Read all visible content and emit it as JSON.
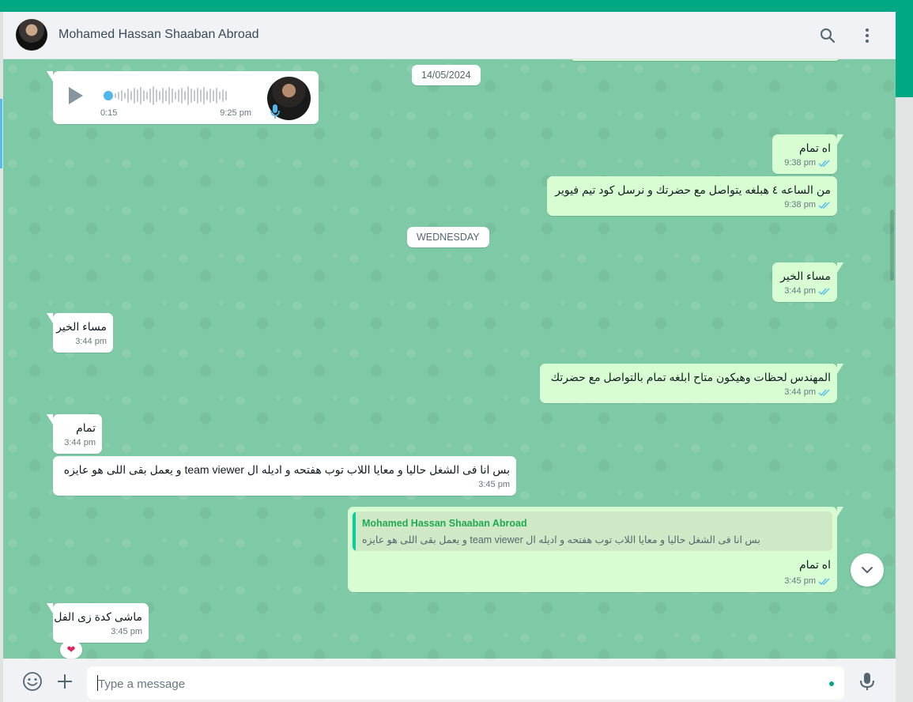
{
  "contact": {
    "name": "Mohamed Hassan Shaaban Abroad"
  },
  "dates": {
    "first": "14/05/2024",
    "second": "WEDNESDAY"
  },
  "voice_note": {
    "duration": "0:15",
    "time": "9:25 pm"
  },
  "messages": [
    {
      "dir": "out",
      "text": "اه تمام",
      "time": "9:38 pm"
    },
    {
      "dir": "out",
      "text": "من الساعه ٤ هبلغه يتواصل مع حضرتك و نرسل كود تيم فيوير",
      "time": "9:38 pm"
    },
    {
      "dir": "out",
      "text": "مساء الخير",
      "time": "3:44 pm"
    },
    {
      "dir": "in",
      "text": "مساء الخير",
      "time": "3:44 pm"
    },
    {
      "dir": "out",
      "text": "المهندس لحظات وهيكون متاح ابلغه تمام بالتواصل مع حضرتك",
      "time": "3:44 pm"
    },
    {
      "dir": "in",
      "text": "تمام",
      "time": "3:44 pm"
    },
    {
      "dir": "in",
      "text": "بس انا فى الشغل حاليا و معايا اللاب توب هفتحه و اديله ال team viewer و يعمل بقى اللى هو عايزه",
      "time": "3:45 pm"
    },
    {
      "dir": "out",
      "text": "اه تمام",
      "time": "3:45 pm"
    },
    {
      "dir": "in",
      "text": "ماشى كدة زى الفل",
      "time": "3:45 pm"
    }
  ],
  "quoted": {
    "name": "Mohamed Hassan Shaaban Abroad",
    "text": "بس انا فى الشغل حاليا و معايا اللاب توب هفتحه و اديله ال team viewer و يعمل بقى اللى هو عايزه"
  },
  "reaction": {
    "emoji": "❤"
  },
  "composer": {
    "placeholder": "Type a message"
  },
  "icons": {
    "search": "search-icon",
    "menu": "menu-icon",
    "emoji": "emoji-icon",
    "attach": "plus-icon",
    "mic": "mic-icon",
    "play": "play-icon",
    "scroll_down": "chevron-down-icon",
    "read": "double-check-icon"
  },
  "colors": {
    "accent": "#00a884",
    "outgoing": "#d9fdd3",
    "incoming": "#ffffff",
    "read_tick": "#53bdeb"
  }
}
